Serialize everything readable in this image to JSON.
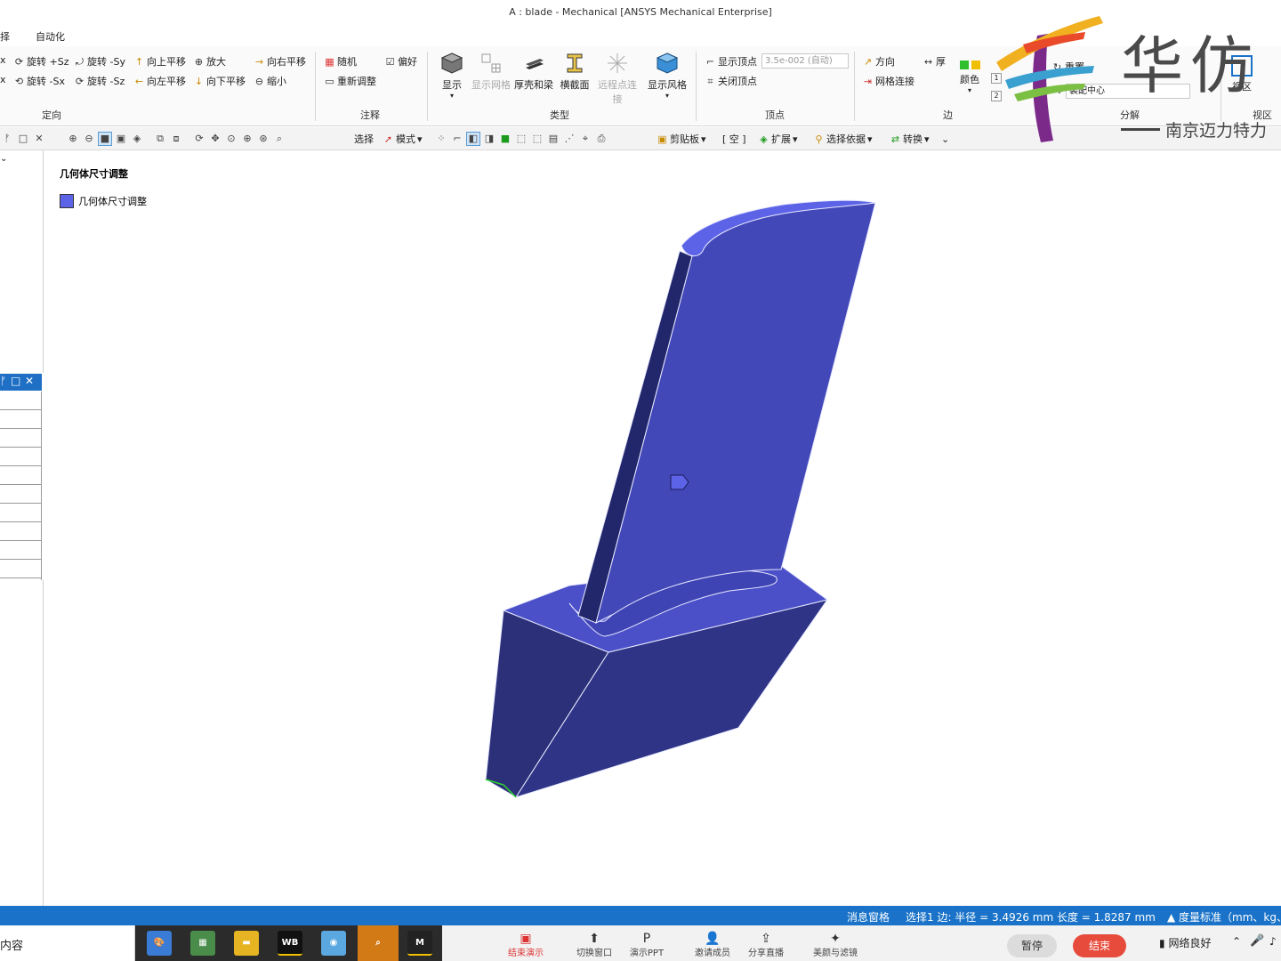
{
  "title": "A : blade - Mechanical [ANSYS Mechanical Enterprise]",
  "menu": {
    "tab_partial": "择",
    "automation": "自动化"
  },
  "ribbon": {
    "orient": {
      "rot_x1": "x",
      "rot_x2": "x",
      "rot_pos_sz": "旋转 +Sz",
      "rot_neg_sy": "旋转 -Sy",
      "pan_up": "向上平移",
      "zoom_in": "放大",
      "pan_right": "向右平移",
      "rot_neg_sx": "旋转 -Sx",
      "rot_neg_sz": "旋转 -Sz",
      "pan_left": "向左平移",
      "pan_down": "向下平移",
      "zoom_out": "缩小",
      "group_label": "定向"
    },
    "annotation": {
      "random": "随机",
      "preference": "偏好",
      "readjust": "重新调整",
      "group_label": "注释"
    },
    "type": {
      "display": "显示",
      "show_mesh": "显示网格",
      "thick_beam": "厚壳和梁",
      "cross_section": "横截面",
      "remote_point": "远程点连接",
      "show_mesh2": "显示风格",
      "group_label": "类型"
    },
    "vertex": {
      "show_vertex": "显示顶点",
      "close_vertex": "关闭顶点",
      "combo": "3.5e-002 (自动)",
      "group_label": "顶点"
    },
    "edge": {
      "direction": "方向",
      "thick": "厚",
      "mesh_connect": "网格连接",
      "color": "颜色",
      "group_label": "边",
      "num1": "1",
      "num2": "2"
    },
    "explode": {
      "reset": "重置",
      "assembly_center": "装配中心",
      "group_label": "分解"
    },
    "viewport": {
      "label": "视区",
      "partial1": "视区"
    }
  },
  "toolbar": {
    "select": "选择",
    "mode": "模式",
    "clipboard": "剪贴板",
    "empty": "[ 空 ]",
    "extend": "扩展",
    "select_by": "选择依据",
    "convert": "转换"
  },
  "viewport": {
    "title": "几何体尺寸调整",
    "legend_label": "几何体尺寸调整",
    "legend_color": "#5c63e6"
  },
  "statusbar": {
    "messages": "消息窗格",
    "selection": "选择1 边: 半径 = 3.4926 mm  长度 = 1.8287 mm",
    "units": "度量标准（mm、kg、"
  },
  "taskbar": {
    "left_text": "内容",
    "apps": [
      "paint-icon",
      "calculator-icon",
      "folder-icon",
      "workbench-icon",
      "app-icon",
      "search-app-icon",
      "mechanical-icon"
    ],
    "wb_label": "WB",
    "m_label": "M",
    "meeting": {
      "end_share": "结束演示",
      "switch_window": "切换窗口",
      "show_ppt": "演示PPT",
      "invite": "邀请成员",
      "share_live": "分享直播",
      "beauty": "美颜与滤镜",
      "pause": "暂停",
      "end": "结束",
      "network": "网络良好"
    }
  },
  "watermark": {
    "brand": "华仿",
    "company": "南京迈力特力"
  },
  "colors": {
    "accent_blue": "#1a73c8",
    "panel_header": "#1f6fc5",
    "model_face": "#4b50c8",
    "end_red": "#e64b3c"
  }
}
